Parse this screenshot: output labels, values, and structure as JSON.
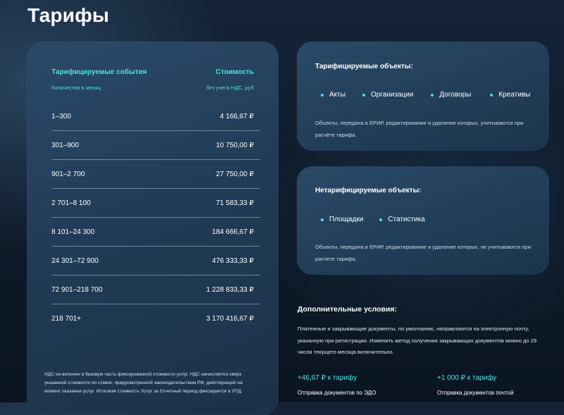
{
  "page": {
    "title": "Тарифы"
  },
  "tariff_table": {
    "col_events_label": "Тарифицируемые события",
    "col_events_sub": "Количество в месяц",
    "col_cost_label": "Стоимость",
    "col_cost_sub": "без учета НДС, руб",
    "rows": [
      {
        "range": "1–300",
        "price": "4 166,67 ₽"
      },
      {
        "range": "301–900",
        "price": "10 750,00 ₽"
      },
      {
        "range": "901–2 700",
        "price": "27 750,00 ₽"
      },
      {
        "range": "2 701–8 100",
        "price": "71 583,33 ₽"
      },
      {
        "range": "8 101–24 300",
        "price": "184 666,67 ₽"
      },
      {
        "range": "24 301–72 900",
        "price": "476 333,33 ₽"
      },
      {
        "range": "72 901–218 700",
        "price": "1 228 833,33 ₽"
      },
      {
        "range": "218 701+",
        "price": "3 170 416,67 ₽"
      }
    ],
    "vat_note": "НДС не включен в базовую часть фиксированной стоимости услуг. НДС начисляется сверх указанной стоимости по ставке, предусмотренной законодательством РФ, действующей на момент оказания услуг. Итоговая стоимость Услуг за Отчетный период фиксируется в УПД."
  },
  "charged_objects": {
    "title": "Тарифицируемые объекты:",
    "items": [
      "Акты",
      "Организации",
      "Договоры",
      "Креативы"
    ],
    "description": "Объекты, передача в ЕРИР, редактирование и удаление которых, учитываются при расчёте тарифа."
  },
  "noncharged_objects": {
    "title": "Нетарифицируемые объекты:",
    "items": [
      "Площадки",
      "Статистика"
    ],
    "description": "Объекты, передача в ЕРИР, редактирование и удаление которых, не учитываются при расчёте тарифа."
  },
  "extra_conditions": {
    "title": "Дополнительные условия:",
    "text": "Платежные и закрывающие документы, по умолчанию, направляются на электронную почту, указанную при регистрации. Изменить метод получения закрывающих документов можно до 29 числа текущего месяца включительно.",
    "options": [
      {
        "price": "+46,67 ₽ к тарифу",
        "label": "Отправка документов по ЭДО"
      },
      {
        "price": "+1 000 ₽ к тарифу",
        "label": "Отправка документов почтой"
      }
    ]
  },
  "colors": {
    "accent": "#4fe0e0",
    "card_bg": "#243f5b",
    "page_bg": "#0f1c2c",
    "text": "#ffffff"
  },
  "icons": {
    "bullet": "bullet-dot-icon"
  }
}
